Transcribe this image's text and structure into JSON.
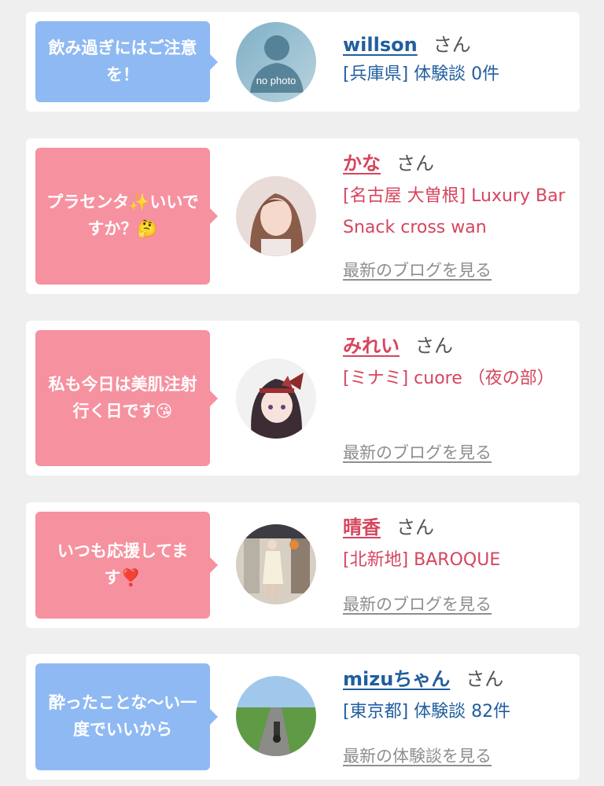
{
  "entries": [
    {
      "message": "飲み過ぎにはご注意を！",
      "name": "willson",
      "suffix": "さん",
      "detail": "[兵庫県] 体験談 0件",
      "link": "",
      "avatar_text": "no photo",
      "theme": "blue"
    },
    {
      "message": "プラセンタ✨いいですか？🤔",
      "name": "かな",
      "suffix": "さん",
      "detail": "[名古屋 大曽根] Luxury Bar Snack cross wan",
      "link": "最新のブログを見る",
      "theme": "pink"
    },
    {
      "message": "私も今日は美肌注射行く日です😘",
      "name": "みれい",
      "suffix": "さん",
      "detail": "[ミナミ] cuore （夜の部）",
      "link": "最新のブログを見る",
      "theme": "pink"
    },
    {
      "message": "いつも応援してます❣️",
      "name": "晴香",
      "suffix": "さん",
      "detail": "[北新地] BAROQUE",
      "link": "最新のブログを見る",
      "theme": "pink"
    },
    {
      "message": "酔ったことな〜い一度でいいから",
      "name": "mizuちゃん",
      "suffix": "さん",
      "detail": "[東京都] 体験談 82件",
      "link": "最新の体験談を見る",
      "theme": "blue"
    }
  ],
  "colors": {
    "blue_bubble": "#8fb9f3",
    "pink_bubble": "#f6919f",
    "blue_text": "#215e9e",
    "pink_text": "#d6455e",
    "background": "#efefef"
  }
}
